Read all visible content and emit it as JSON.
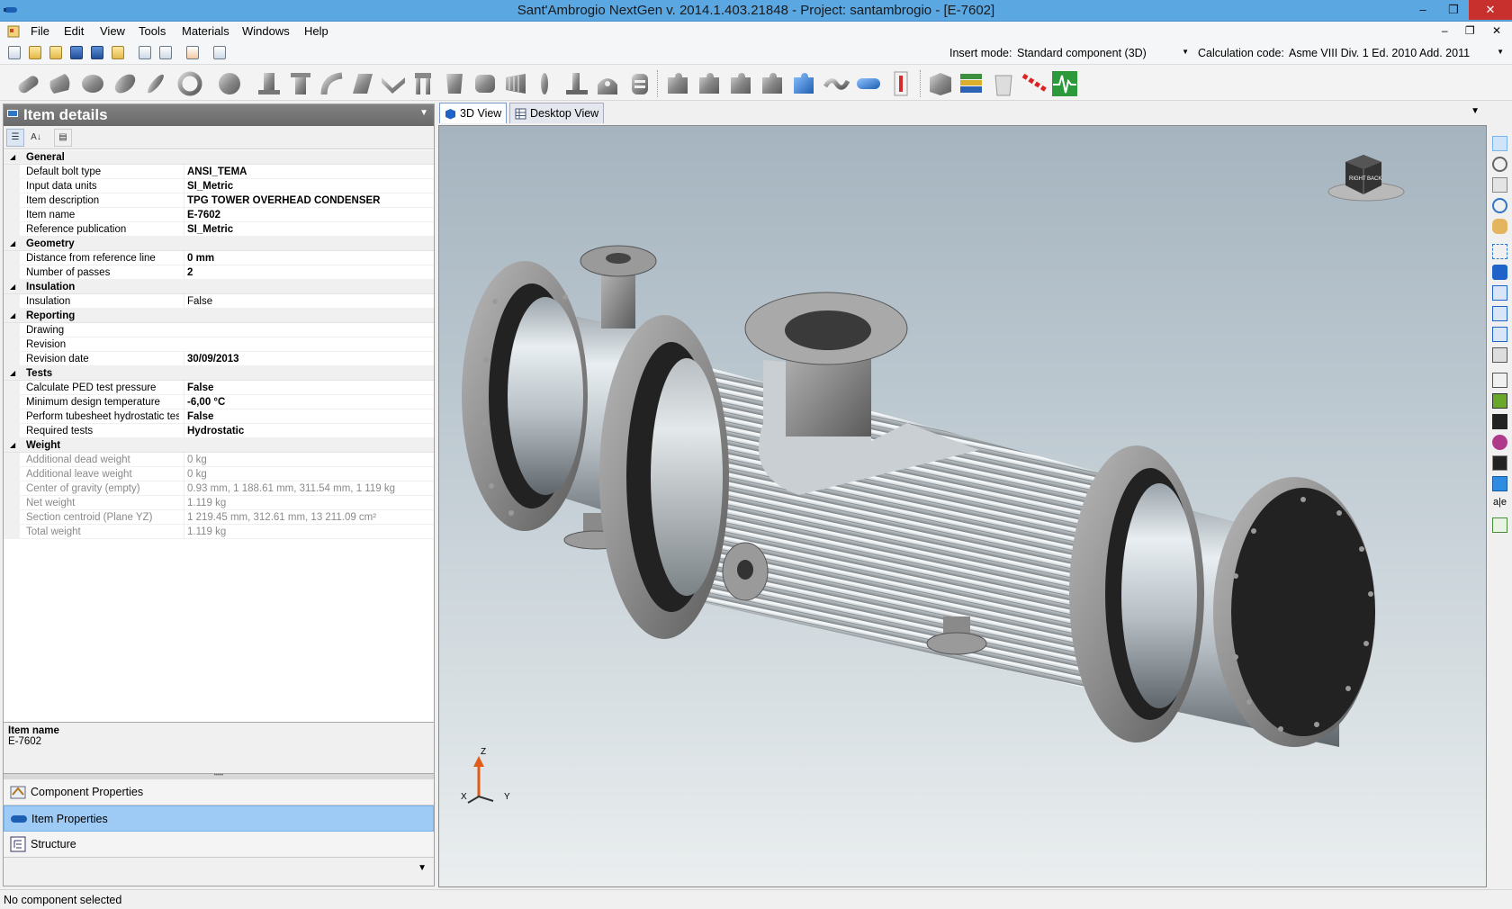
{
  "window": {
    "title": "Sant'Ambrogio NextGen  v. 2014.1.403.21848 - Project: santambrogio - [E-7602]",
    "controls": [
      "minimize",
      "maximize",
      "close"
    ]
  },
  "menu": [
    "File",
    "Edit",
    "View",
    "Tools",
    "Materials",
    "Windows",
    "Help"
  ],
  "quickbar": {
    "insert_mode_label": "Insert mode:",
    "insert_mode_value": "Standard component (3D)",
    "calc_code_label": "Calculation code:",
    "calc_code_value": "Asme VIII Div. 1 Ed. 2010 Add. 2011"
  },
  "left_panel": {
    "title": "Item details",
    "categories": [
      {
        "name": "General",
        "props": [
          {
            "name": "Default bolt type",
            "value": "ANSI_TEMA"
          },
          {
            "name": "Input data units",
            "value": "SI_Metric"
          },
          {
            "name": "Item description",
            "value": "TPG TOWER OVERHEAD CONDENSER"
          },
          {
            "name": "Item name",
            "value": "E-7602"
          },
          {
            "name": "Reference publication",
            "value": "SI_Metric"
          }
        ]
      },
      {
        "name": "Geometry",
        "props": [
          {
            "name": "Distance from reference line",
            "value": "0 mm"
          },
          {
            "name": "Number of passes",
            "value": "2"
          }
        ]
      },
      {
        "name": "Insulation",
        "props": [
          {
            "name": "Insulation",
            "value": "False"
          }
        ]
      },
      {
        "name": "Reporting",
        "props": [
          {
            "name": "Drawing",
            "value": ""
          },
          {
            "name": "Revision",
            "value": ""
          },
          {
            "name": "Revision date",
            "value": "30/09/2013"
          }
        ]
      },
      {
        "name": "Tests",
        "props": [
          {
            "name": "Calculate PED test pressure",
            "value": "False"
          },
          {
            "name": "Minimum design temperature",
            "value": "-6,00 °C"
          },
          {
            "name": "Perform tubesheet hydrostatic test",
            "value": "False"
          },
          {
            "name": "Required tests",
            "value": "Hydrostatic"
          }
        ]
      },
      {
        "name": "Weight",
        "props": [
          {
            "name": "Additional dead weight",
            "value": "0 kg"
          },
          {
            "name": "Additional leave weight",
            "value": "0 kg"
          },
          {
            "name": "Center of gravity (empty)",
            "value": "0.93 mm, 1 188.61 mm, 311.54 mm, 1 119 kg"
          },
          {
            "name": "Net weight",
            "value": "1.119 kg"
          },
          {
            "name": "Section centroid (Plane YZ)",
            "value": "1 219.45 mm, 312.61 mm, 13 211.09 cm²"
          },
          {
            "name": "Total weight",
            "value": "1.119 kg"
          }
        ]
      }
    ],
    "description_title": "Item name",
    "description_value": "E-7602",
    "nav": [
      "Component Properties",
      "Item Properties",
      "Structure"
    ]
  },
  "tabs": [
    "3D View",
    "Desktop View"
  ],
  "viewcube": {
    "right": "RIGHT",
    "back": "BACK"
  },
  "axes": {
    "z": "Z",
    "x": "X",
    "y": "Y"
  },
  "status": "No component selected",
  "colors": {
    "title_bar": "#5aa7e2",
    "selected_nav": "#9ecbf6",
    "close_button": "#c7302c"
  }
}
